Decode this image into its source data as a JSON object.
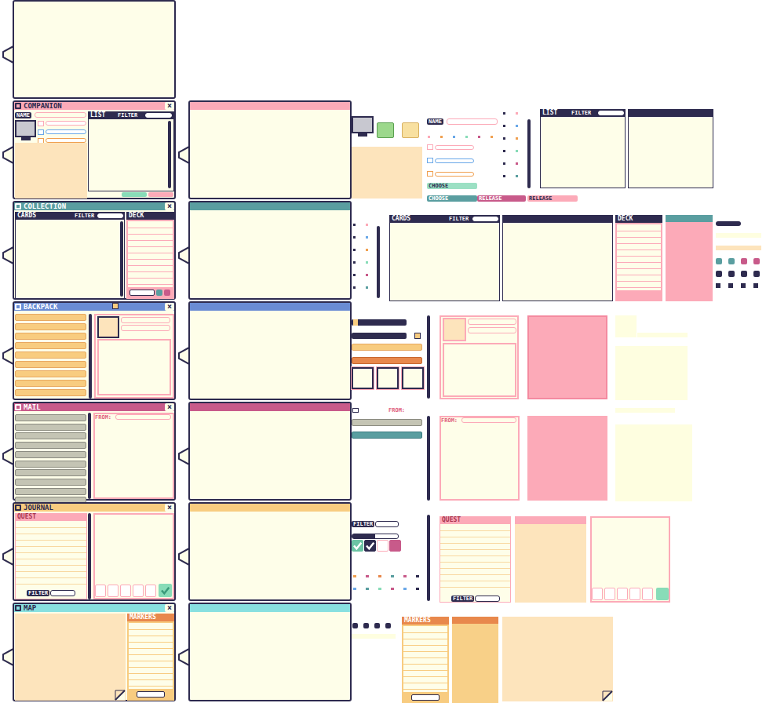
{
  "rows": [
    {
      "title": "COMPANION",
      "close": "×",
      "color": "#fcaab8",
      "name_label": "NAME",
      "list_title": "LIST",
      "filter_label": "FILTER",
      "parts": {
        "name_label": "NAME",
        "list_title": "LIST",
        "filter_label": "FILTER",
        "buttons": [
          {
            "label": "CHOOSE",
            "color": "#9ce0c4"
          },
          {
            "label": "CHOOSE",
            "color": "#5a9ea0"
          },
          {
            "label": "RELEASE",
            "color": "#c85a8a"
          },
          {
            "label": "RELEASE",
            "color": "#fcaab8"
          }
        ]
      }
    },
    {
      "title": "COLLECTION",
      "close": "×",
      "color": "#5a9ea0",
      "cards_title": "CARDS",
      "filter_label": "FILTER",
      "deck_title": "DECK",
      "parts": {
        "cards_title": "CARDS",
        "filter_label": "FILTER",
        "deck_title": "DECK"
      }
    },
    {
      "title": "BACKPACK",
      "close": "×",
      "color": "#6a8cd4"
    },
    {
      "title": "MAIL",
      "close": "×",
      "color": "#c85a8a",
      "from_label": "FROM:",
      "parts": {
        "header_from": "FROM:",
        "from_label": "FROM:"
      }
    },
    {
      "title": "JOURNAL",
      "close": "×",
      "color": "#f8cc80",
      "quest_title": "QUEST",
      "filter_label": "FILTER",
      "done": true,
      "parts": {
        "filter_label": "FILTER",
        "progress": {
          "level": 0.5
        },
        "checks": [
          {
            "checked": true,
            "color": "#6cc4a4"
          },
          {
            "checked": true,
            "color": "#2e2b4f"
          },
          {
            "checked": false,
            "color": "#ffffff"
          },
          {
            "checked": false,
            "color": "#c85a8a"
          }
        ],
        "quest_title": "QUEST",
        "quest_filter": "FILTER"
      }
    },
    {
      "title": "MAP",
      "close": "×",
      "color": "#88e0e0",
      "markers_title": "MARKERS",
      "parts": {
        "markers_title": "MARKERS"
      }
    }
  ]
}
